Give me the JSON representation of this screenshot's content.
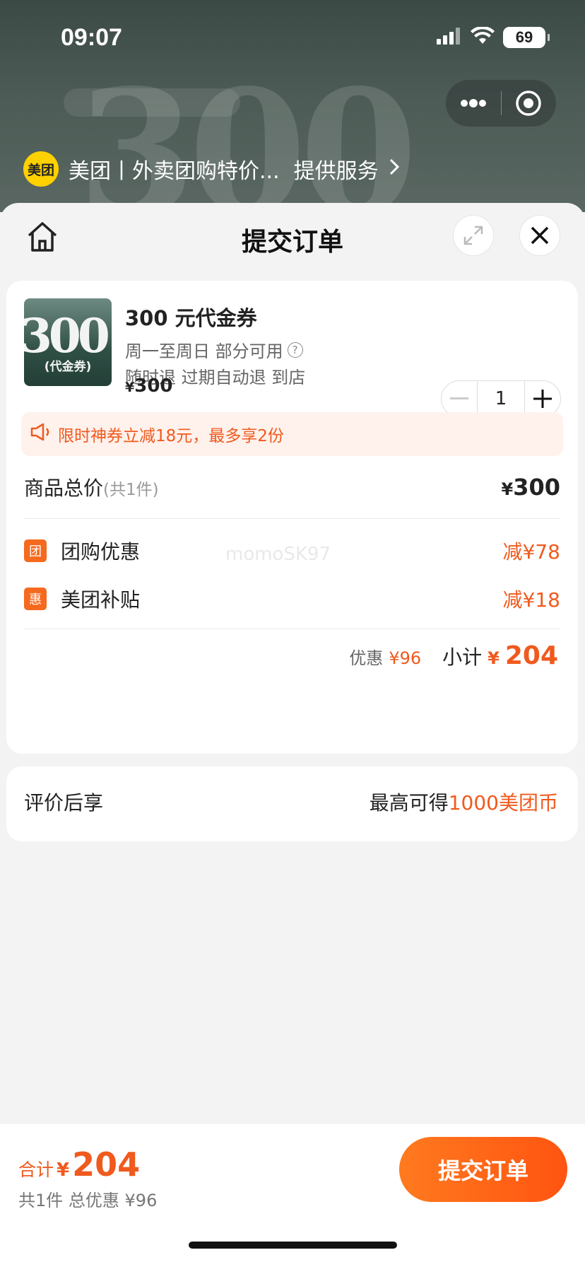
{
  "status": {
    "time": "09:07",
    "battery": "69"
  },
  "mini": {
    "provider": "美团丨外卖团购特价...",
    "service": "提供服务",
    "logo_text": "美团"
  },
  "header": {
    "title": "提交订单"
  },
  "product": {
    "title": "300 元代金券",
    "thumb_number": "300",
    "thumb_label": "(代金券)",
    "line1": "周一至周日 部分可用",
    "line2": "随时退 过期自动退 到店",
    "price_symbol": "¥",
    "price": "300",
    "quantity": "1"
  },
  "promo": {
    "text": "限时神券立减18元，最多享2份"
  },
  "summary": {
    "total_label": "商品总价",
    "total_count": "(共1件)",
    "total_symbol": "¥",
    "total_value": "300",
    "discounts": [
      {
        "tag": "团",
        "label": "团购优惠",
        "value": "减¥78"
      },
      {
        "tag": "惠",
        "label": "美团补贴",
        "value": "减¥18"
      }
    ],
    "watermark": "momoSK97",
    "discount_label": "优惠",
    "discount_value": "¥96",
    "subtotal_label": "小计",
    "subtotal_symbol": "¥",
    "subtotal_value": "204"
  },
  "review": {
    "label": "评价后享",
    "reward_prefix": "最高可得",
    "reward_value": "1000美团币"
  },
  "footer": {
    "sum_label": "合计",
    "sum_symbol": "¥",
    "sum_value": "204",
    "sub": "共1件 总优惠 ¥96",
    "submit": "提交订单"
  },
  "colors": {
    "accent": "#f05a1e",
    "brand_yellow": "#ffd100"
  }
}
